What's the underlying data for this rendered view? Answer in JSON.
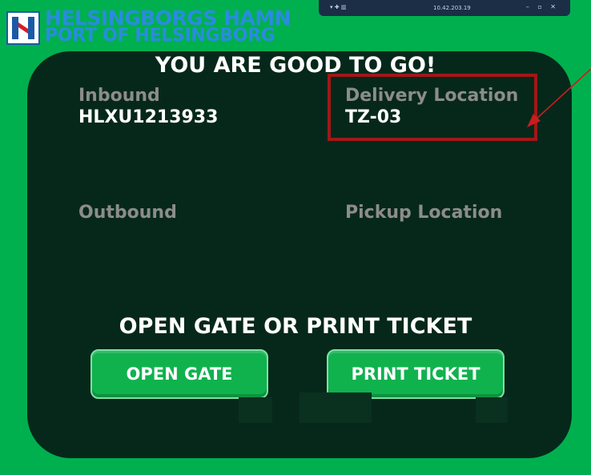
{
  "logo": {
    "line1": "HELSINGBORGS HAMN",
    "line2": "PORT OF HELSINGBORG"
  },
  "remote_bar": {
    "host": "10.42.203.19",
    "controls": "– ▫ ✕"
  },
  "main": {
    "headline": "YOU ARE GOOD TO GO!",
    "inbound_label": "Inbound",
    "inbound_value": "HLXU1213933",
    "delivery_label": "Delivery Location",
    "delivery_value": "TZ-03",
    "outbound_label": "Outbound",
    "pickup_label": "Pickup Location",
    "subheadline": "OPEN GATE OR PRINT TICKET"
  },
  "buttons": {
    "open_gate": "OPEN GATE",
    "print_ticket": "PRINT TICKET"
  },
  "colors": {
    "background_green": "#00b04f",
    "panel_dark": "#06281a",
    "label_gray": "#8c8c8c",
    "annotation_red": "#a01818",
    "logo_blue": "#2a8be0"
  }
}
